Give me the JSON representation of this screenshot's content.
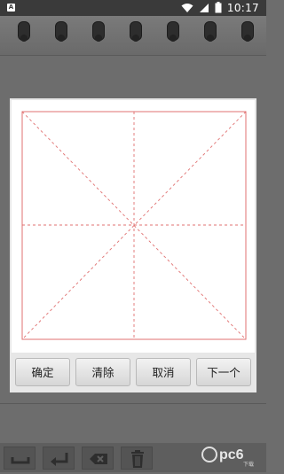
{
  "status_bar": {
    "app_icon_letter": "A",
    "time": "10:17",
    "icons": [
      "wifi-icon",
      "signal-icon",
      "battery-icon"
    ]
  },
  "dialog": {
    "buttons": {
      "confirm": "确定",
      "clear": "清除",
      "cancel": "取消",
      "next": "下一个"
    },
    "grid_color": "#e07070"
  },
  "toolbar": {
    "tools": [
      "space-icon",
      "enter-icon",
      "backspace-icon",
      "trash-icon"
    ]
  },
  "watermark": {
    "text": "pc6",
    "sub": "下载"
  }
}
